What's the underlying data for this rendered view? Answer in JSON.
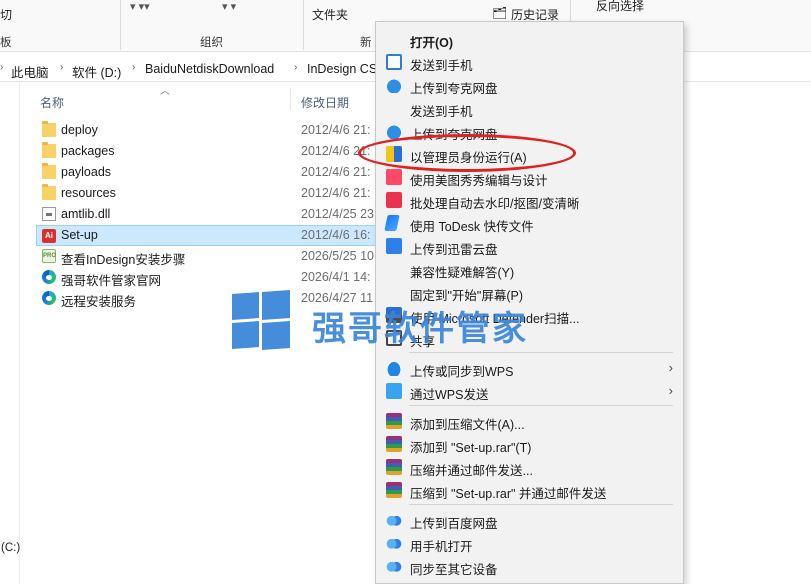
{
  "ribbon": {
    "group_left_cut": "板",
    "group_left_top": "切",
    "group_organize": "组织",
    "group_new_cut": "新",
    "folder_label": "文件夹",
    "history": "历史记录",
    "reverse_select": "反向选择"
  },
  "address": {
    "crumbs": [
      "此电脑",
      "软件 (D:)",
      "BaiduNetdiskDownload",
      "InDesign CS"
    ]
  },
  "list": {
    "col_name": "名称",
    "col_modified": "修改日期",
    "rows": [
      {
        "name": "deploy",
        "date": "2012/4/6 21:",
        "icon": "folder"
      },
      {
        "name": "packages",
        "date": "2012/4/6 21:",
        "icon": "folder"
      },
      {
        "name": "payloads",
        "date": "2012/4/6 21:",
        "icon": "folder"
      },
      {
        "name": "resources",
        "date": "2012/4/6 21:",
        "icon": "folder"
      },
      {
        "name": "amtlib.dll",
        "date": "2012/4/25 23",
        "icon": "dll"
      },
      {
        "name": "Set-up",
        "date": "2012/4/6 16:",
        "icon": "adobe-setup",
        "selected": true
      },
      {
        "name": "查看InDesign安装步骤",
        "date": "2026/5/25 10",
        "icon": "pro-doc"
      },
      {
        "name": "强哥软件管家官网",
        "date": "2026/4/1 14:",
        "icon": "edge"
      },
      {
        "name": "远程安装服务",
        "date": "2026/4/27 11",
        "icon": "edge"
      }
    ]
  },
  "nav": {
    "drive_label": "(C:)"
  },
  "watermark": {
    "text": "强哥软件管家"
  },
  "menu": {
    "items": [
      {
        "label": "打开(O)",
        "icon": "",
        "bold": true
      },
      {
        "label": "发送到手机",
        "icon": "phone-icon"
      },
      {
        "label": "上传到夸克网盘",
        "icon": "quark-cloud-icon"
      },
      {
        "label": "发送到手机",
        "icon": ""
      },
      {
        "label": "上传到夸克网盘",
        "icon": "quark-cloud-icon"
      },
      {
        "label": "以管理员身份运行(A)",
        "icon": "uac-shield-icon"
      },
      {
        "label": "使用美图秀秀编辑与设计",
        "icon": "meitu-icon"
      },
      {
        "label": "批处理自动去水印/抠图/变清晰",
        "icon": "batch-icon"
      },
      {
        "label": "使用 ToDesk 快传文件",
        "icon": "todesk-icon"
      },
      {
        "label": "上传到迅雷云盘",
        "icon": "xunlei-icon"
      },
      {
        "label": "兼容性疑难解答(Y)",
        "icon": ""
      },
      {
        "label": "固定到\"开始\"屏幕(P)",
        "icon": ""
      },
      {
        "label": "使用 Microsoft Defender扫描...",
        "icon": "defender-icon"
      },
      {
        "label": "共享",
        "icon": "share-icon"
      },
      {
        "label": "上传或同步到WPS",
        "icon": "wps-cloud-icon",
        "submenu": true
      },
      {
        "label": "通过WPS发送",
        "icon": "wps-send-icon",
        "submenu": true
      },
      {
        "label": "添加到压缩文件(A)...",
        "icon": "winrar-icon"
      },
      {
        "label": "添加到 \"Set-up.rar\"(T)",
        "icon": "winrar-icon"
      },
      {
        "label": "压缩并通过邮件发送...",
        "icon": "winrar-icon"
      },
      {
        "label": "压缩到 \"Set-up.rar\" 并通过邮件发送",
        "icon": "winrar-icon"
      },
      {
        "label": "上传到百度网盘",
        "icon": "baidu-netdisk-icon"
      },
      {
        "label": "用手机打开",
        "icon": "baidu-netdisk-icon"
      },
      {
        "label": "同步至其它设备",
        "icon": "baidu-netdisk-icon"
      }
    ]
  },
  "colors": {
    "accent": "#3b86d8",
    "annotation": "#e0211e",
    "selection": "#cce8ff"
  }
}
